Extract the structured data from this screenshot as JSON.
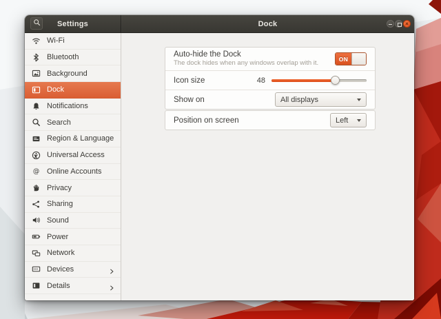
{
  "titlebar": {
    "settings_title": "Settings",
    "panel_title": "Dock"
  },
  "sidebar": {
    "items": [
      {
        "label": "Wi-Fi",
        "icon": "wifi",
        "selected": false,
        "chevron": false
      },
      {
        "label": "Bluetooth",
        "icon": "bluetooth",
        "selected": false,
        "chevron": false
      },
      {
        "label": "Background",
        "icon": "background",
        "selected": false,
        "chevron": false
      },
      {
        "label": "Dock",
        "icon": "dock",
        "selected": true,
        "chevron": false
      },
      {
        "label": "Notifications",
        "icon": "notifications",
        "selected": false,
        "chevron": false
      },
      {
        "label": "Search",
        "icon": "search",
        "selected": false,
        "chevron": false
      },
      {
        "label": "Region & Language",
        "icon": "region",
        "selected": false,
        "chevron": false
      },
      {
        "label": "Universal Access",
        "icon": "universal-access",
        "selected": false,
        "chevron": false
      },
      {
        "label": "Online Accounts",
        "icon": "online-accounts",
        "selected": false,
        "chevron": false
      },
      {
        "label": "Privacy",
        "icon": "privacy",
        "selected": false,
        "chevron": false
      },
      {
        "label": "Sharing",
        "icon": "sharing",
        "selected": false,
        "chevron": false
      },
      {
        "label": "Sound",
        "icon": "sound",
        "selected": false,
        "chevron": false
      },
      {
        "label": "Power",
        "icon": "power",
        "selected": false,
        "chevron": false
      },
      {
        "label": "Network",
        "icon": "network",
        "selected": false,
        "chevron": false
      },
      {
        "label": "Devices",
        "icon": "devices",
        "selected": false,
        "chevron": true
      },
      {
        "label": "Details",
        "icon": "details",
        "selected": false,
        "chevron": true
      }
    ]
  },
  "panel": {
    "autohide": {
      "title": "Auto-hide the Dock",
      "subtitle": "The dock hides when any windows overlap with it.",
      "toggle_label": "ON",
      "toggle_state": "on"
    },
    "icon_size": {
      "label": "Icon size",
      "value": "48",
      "slider_percent": 67
    },
    "show_on": {
      "label": "Show on",
      "value": "All displays"
    },
    "position": {
      "label": "Position on screen",
      "value": "Left"
    }
  },
  "colors": {
    "accent_orange": "#DD5F35",
    "selected_item_orange": "#E06B44",
    "toggle_on_orange": "#E0551F",
    "slider_fill_orange": "#E8521F",
    "close_button_orange": "#E95420"
  }
}
